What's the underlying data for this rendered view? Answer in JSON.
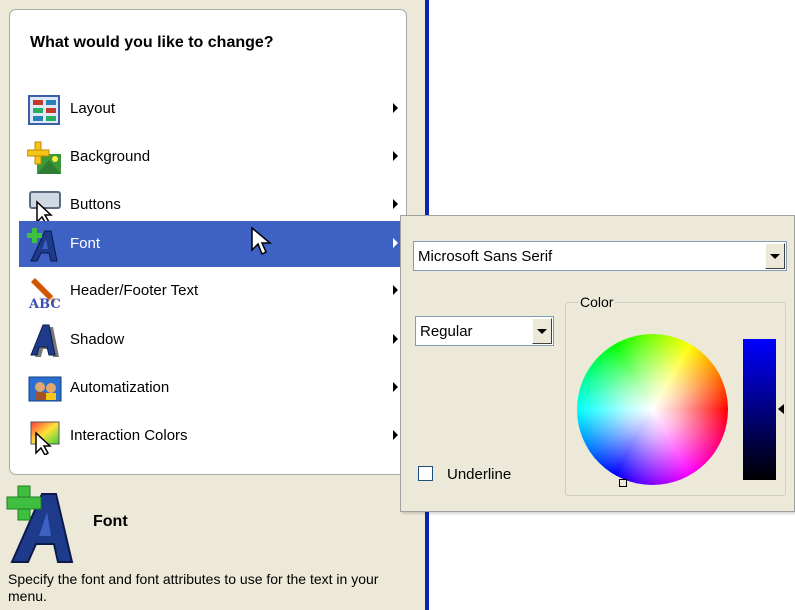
{
  "menu": {
    "heading": "What would you like to change?",
    "items": [
      {
        "label": "Layout",
        "icon": "layout-icon",
        "selected": false
      },
      {
        "label": "Background",
        "icon": "background-icon",
        "selected": false
      },
      {
        "label": "Buttons",
        "icon": "buttons-icon",
        "selected": false
      },
      {
        "label": "Font",
        "icon": "font-icon",
        "selected": true
      },
      {
        "label": "Header/Footer Text",
        "icon": "header-footer-text-icon",
        "selected": false
      },
      {
        "label": "Shadow",
        "icon": "shadow-icon",
        "selected": false
      },
      {
        "label": "Automatization",
        "icon": "automatization-icon",
        "selected": false
      },
      {
        "label": "Interaction Colors",
        "icon": "interaction-colors-icon",
        "selected": false
      }
    ]
  },
  "description": {
    "title": "Font",
    "text": "Specify the font and font attributes to use for the text in your menu."
  },
  "font_panel": {
    "font_name": "Microsoft Sans Serif",
    "font_style": "Regular",
    "underline_label": "Underline",
    "underline_checked": false,
    "color_group_label": "Color"
  },
  "colors": {
    "selection": "#3d62c4",
    "divider": "#0a24b0",
    "panel_bg": "#ece9d8",
    "selected_color": "#0000ff"
  }
}
